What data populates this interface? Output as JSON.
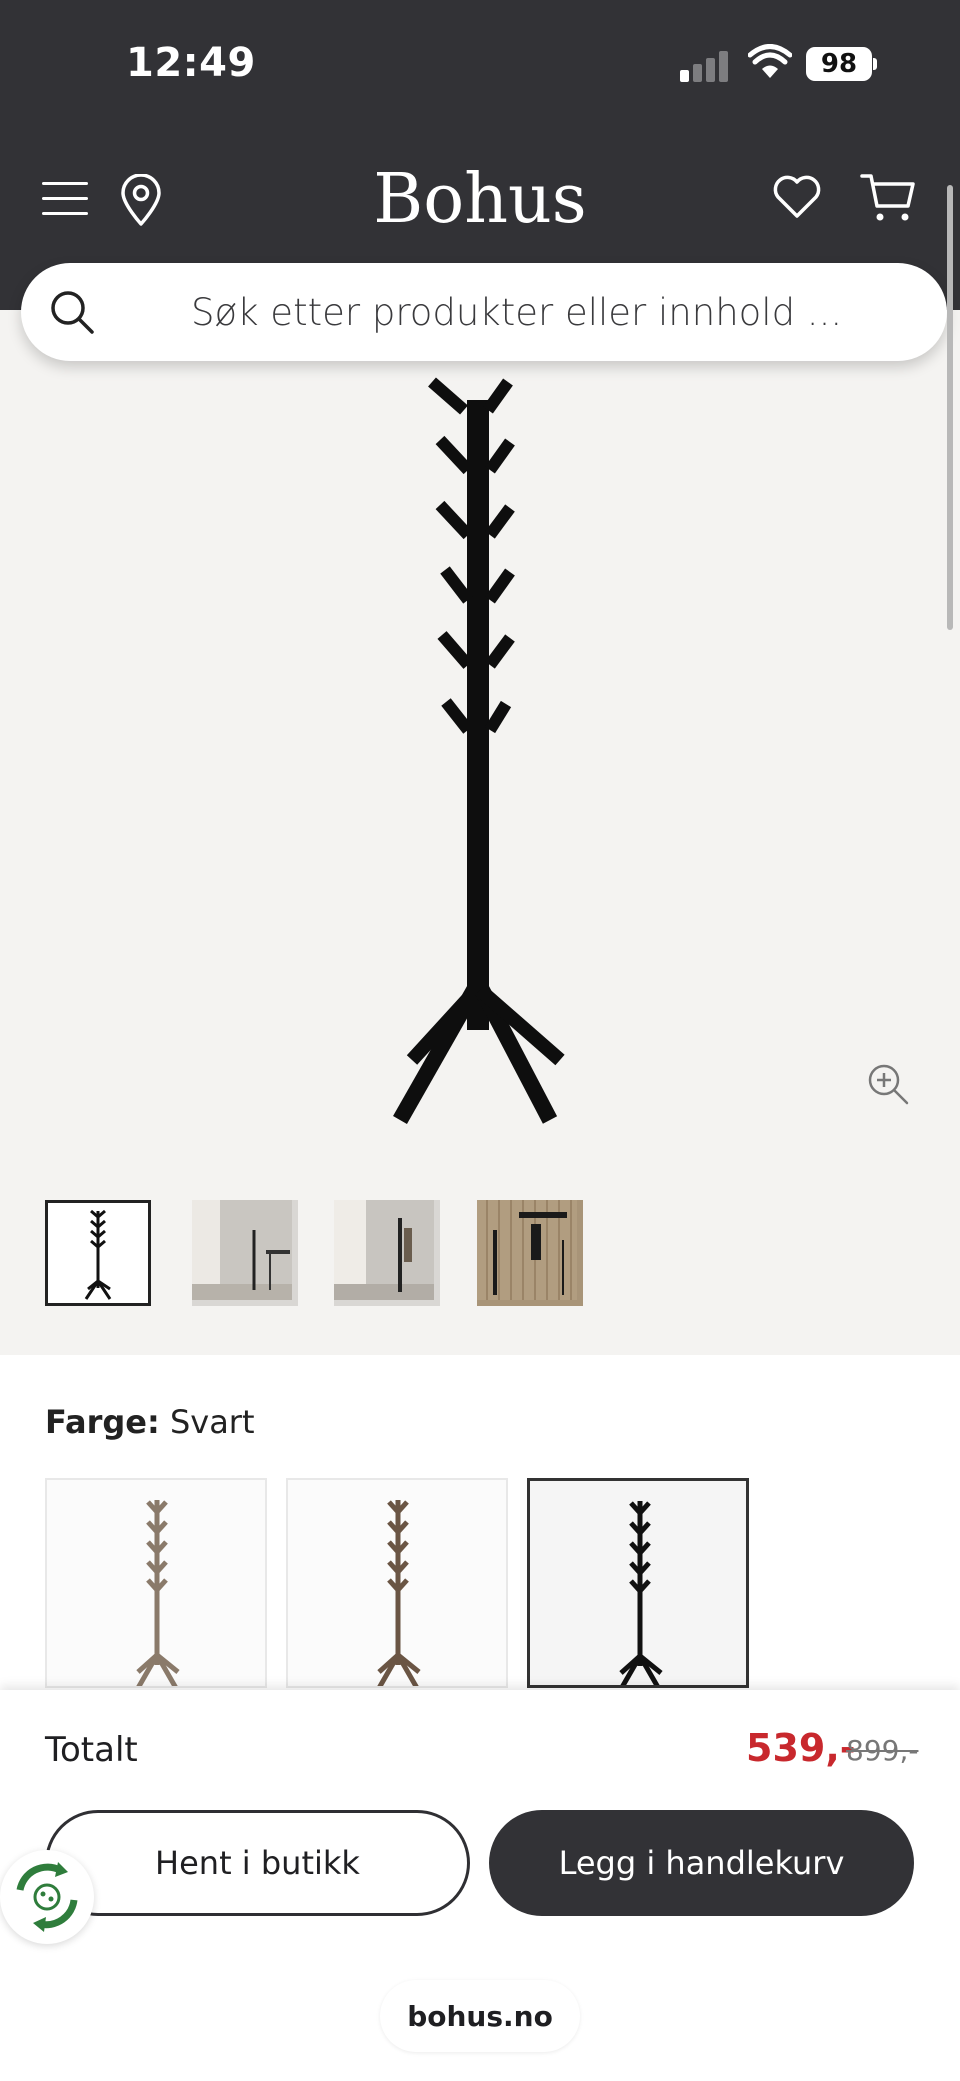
{
  "status_bar": {
    "time": "12:49",
    "battery": "98"
  },
  "header": {
    "brand": "Bohus",
    "icons": [
      "menu-icon",
      "location-icon",
      "heart-icon",
      "cart-icon"
    ]
  },
  "search": {
    "placeholder": "Søk etter produkter eller innhold ..."
  },
  "product": {
    "color_label": "Farge:",
    "color_value": "Svart",
    "thumbnails": [
      "thumb-1",
      "thumb-2",
      "thumb-3",
      "thumb-4"
    ],
    "swatches": [
      "light-oak",
      "walnut",
      "black"
    ],
    "swatch_colors": [
      "#8a7a6a",
      "#6a5544",
      "#111111"
    ]
  },
  "bottom_bar": {
    "total_label": "Totalt",
    "price": "539,-",
    "old_price": "899,-",
    "pickup_button": "Hent i butikk",
    "cart_button": "Legg i handlekurv"
  },
  "browser": {
    "url": "bohus.no"
  },
  "colors": {
    "header_bg": "#323236",
    "price_red": "#c8282d",
    "gallery_bg": "#f4f3f1"
  }
}
